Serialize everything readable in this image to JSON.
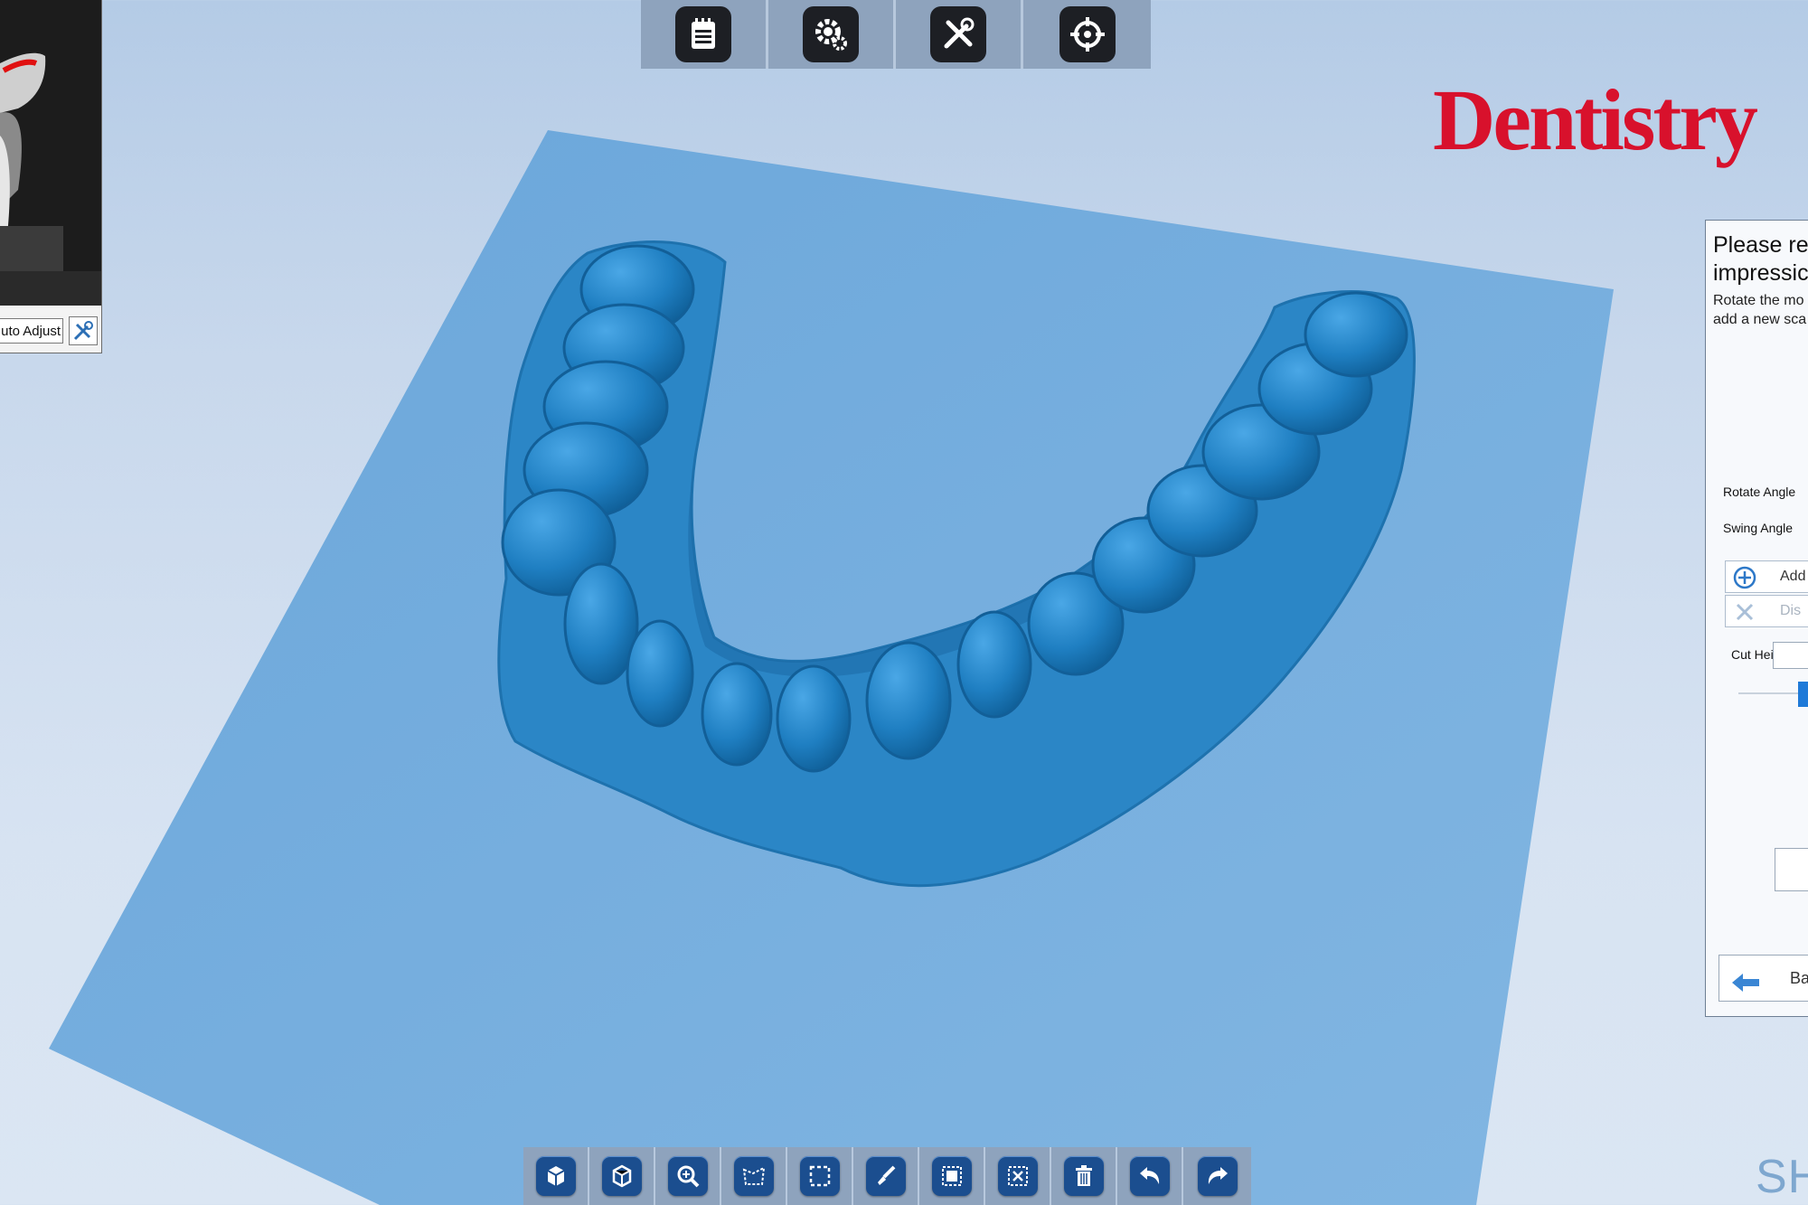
{
  "preview": {
    "auto_adjust_label": "uto Adjust"
  },
  "top_toolbar": {
    "buttons": [
      {
        "icon": "notepad-icon"
      },
      {
        "icon": "settings-gear-icon"
      },
      {
        "icon": "tools-icon"
      },
      {
        "icon": "crosshair-target-icon"
      }
    ]
  },
  "logo": {
    "text": "Dentistry",
    "color": "#d8112c"
  },
  "right_panel": {
    "heading_line1": "Please re",
    "heading_line2": "impressic",
    "description_line1": "Rotate the mo",
    "description_line2": "add a new sca",
    "rotate_angle_label": "Rotate Angle",
    "swing_angle_label": "Swing Angle",
    "add_button_label": "Add",
    "discard_button_label": "Dis",
    "cut_height_label": "Cut Height",
    "back_button_label": "Ba"
  },
  "bottom_toolbar": {
    "buttons": [
      {
        "icon": "view-cube-front-icon"
      },
      {
        "icon": "view-cube-top-icon"
      },
      {
        "icon": "zoom-icon"
      },
      {
        "icon": "select-region-icon"
      },
      {
        "icon": "rectangle-select-icon"
      },
      {
        "icon": "brush-icon"
      },
      {
        "icon": "select-all-icon"
      },
      {
        "icon": "invert-selection-icon"
      },
      {
        "icon": "delete-icon"
      },
      {
        "icon": "undo-icon"
      },
      {
        "icon": "redo-icon"
      }
    ]
  },
  "corner_brand": "SH",
  "colors": {
    "model_blue": "#2a86c7",
    "plane_blue": "#6aa8dc",
    "toolbar_gray": "#8ea3bd"
  }
}
